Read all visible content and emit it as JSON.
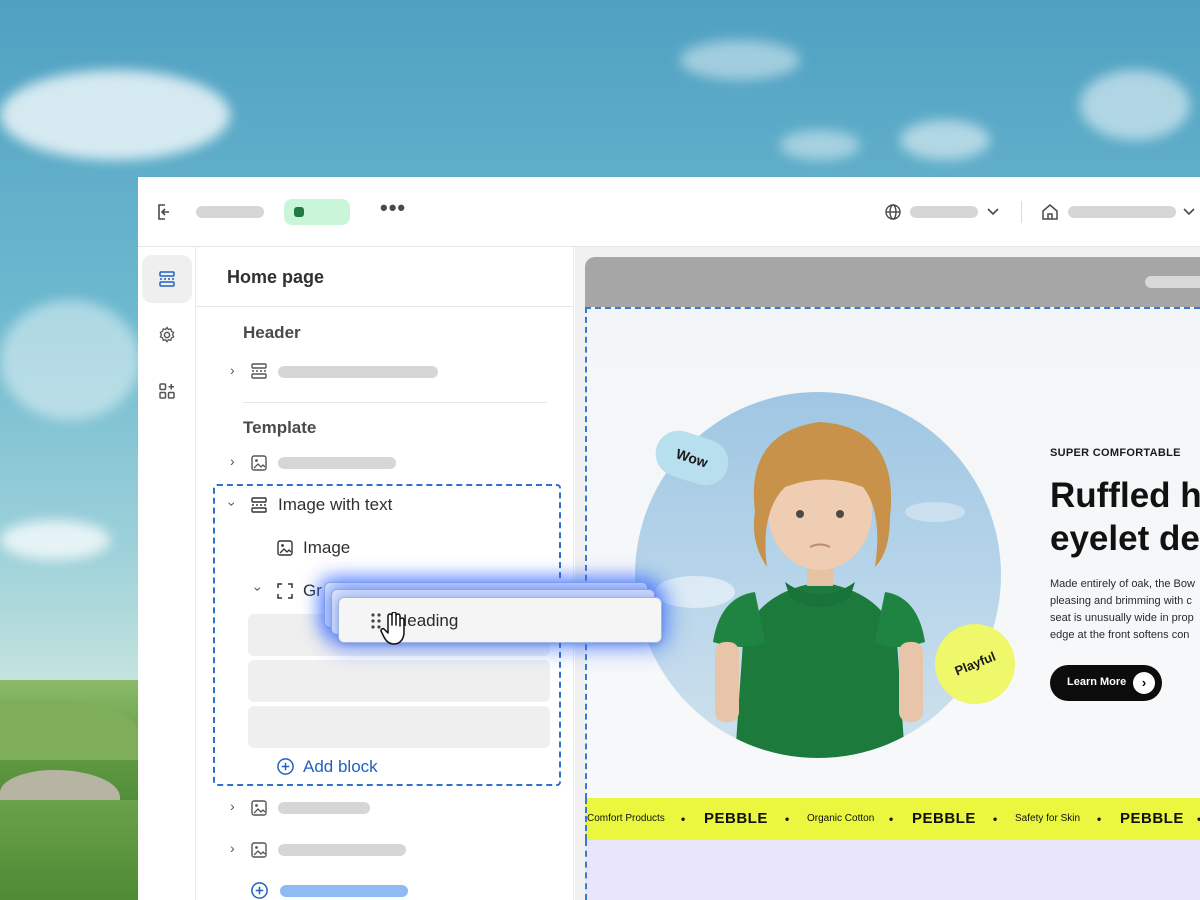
{
  "topbar": {
    "status_color": "#1f7a45"
  },
  "sidebar": {
    "page_title": "Home page",
    "groups": {
      "header": "Header",
      "template": "Template"
    },
    "section": {
      "title": "Image with text",
      "children": {
        "image": "Image",
        "group": "Gr"
      },
      "add_block": "Add block"
    }
  },
  "drag": {
    "label": "Heading"
  },
  "preview": {
    "tags": {
      "wow": "Wow",
      "playful": "Playful"
    },
    "eyebrow": "SUPER COMFORTABLE",
    "title_line1": "Ruffled h",
    "title_line2": "eyelet de",
    "body_lines": [
      "Made entirely of oak, the Bow",
      "pleasing and brimming with c",
      "seat is unusually wide in prop",
      "edge at the front softens con"
    ],
    "cta": "Learn More",
    "marquee": {
      "items": [
        "Comfort Products",
        "PEBBLE",
        "Organic Cotton",
        "PEBBLE",
        "Safety for Skin",
        "PEBBLE"
      ],
      "separator": "•"
    }
  },
  "colors": {
    "accent": "#2161c4",
    "marquee_bg": "#eaf73e",
    "playful_bg": "#eef86a",
    "wow_bg": "#b7dfee"
  }
}
